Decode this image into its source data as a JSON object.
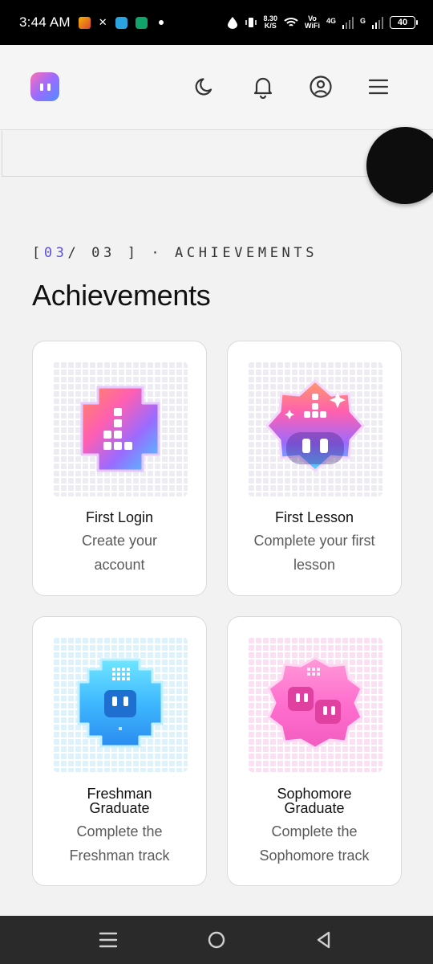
{
  "status_bar": {
    "time": "3:44 AM",
    "speed_value": "8.30",
    "speed_unit": "K/S",
    "vowifi_top": "Vo",
    "vowifi_bottom": "WiFi",
    "net_4g": "4G",
    "net_g": "G",
    "battery": "40",
    "icons": [
      "office-app-icon",
      "x-app-icon",
      "telegram-app-icon",
      "kc-app-icon",
      "notification-dot-icon",
      "data-saver-icon",
      "vibrate-icon",
      "wifi-icon",
      "signal-icon",
      "battery-icon"
    ]
  },
  "header": {
    "icons": [
      "app-logo",
      "moon-icon",
      "bell-icon",
      "user-icon",
      "menu-icon"
    ]
  },
  "section": {
    "label_open": "[",
    "label_current": "03",
    "label_rest": "/ 03 ] · ACHIEVEMENTS",
    "title": "Achievements"
  },
  "achievements": [
    {
      "title": "First Login",
      "description_line1": "Create your",
      "description_line2": "account",
      "badge": "pink-blue-cross-badge"
    },
    {
      "title": "First Lesson",
      "description_line1": "Complete your first",
      "description_line2": "lesson",
      "badge": "sparkle-face-badge"
    },
    {
      "title_line1": "Freshman",
      "title_line2": "Graduate",
      "description_line1": "Complete the",
      "description_line2": "Freshman track",
      "badge": "blue-face-badge"
    },
    {
      "title_line1": "Sophomore",
      "title_line2": "Graduate",
      "description_line1": "Complete the",
      "description_line2": "Sophomore track",
      "badge": "pink-double-face-badge"
    }
  ],
  "colors": {
    "accent": "#5a4fe0",
    "badge_pink": "#ff5fb0",
    "badge_blue": "#3fb8ff",
    "badge_purple": "#8a5cff"
  },
  "nav": {
    "icons": [
      "recent-apps-icon",
      "home-icon",
      "back-icon"
    ]
  }
}
